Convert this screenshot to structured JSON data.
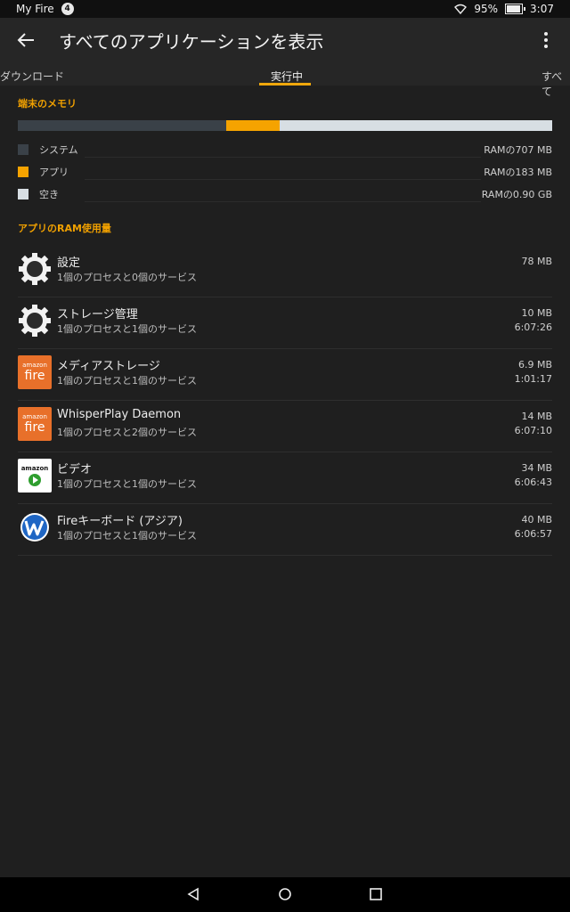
{
  "status_bar": {
    "carrier": "My Fire",
    "notification_count": "4",
    "battery": "95%",
    "time": "3:07",
    "icons": [
      "wifi-icon",
      "battery-charging-icon"
    ]
  },
  "app_bar": {
    "title": "すべてのアプリケーションを表示",
    "back_icon": "back-arrow-icon",
    "menu_icon": "overflow-menu-icon"
  },
  "tabs": {
    "items": [
      {
        "label": "ダウンロード"
      },
      {
        "label": "実行中",
        "selected": true
      },
      {
        "label": "すべて"
      }
    ]
  },
  "memory": {
    "header": "端末のメモリ",
    "usage": [
      {
        "label": "システム",
        "value": "RAMの707 MB",
        "color": "#3a4148",
        "fraction": 0.39
      },
      {
        "label": "アプリ",
        "value": "RAMの183 MB",
        "color": "#f5a300",
        "fraction": 0.1
      },
      {
        "label": "空き",
        "value": "RAMの0.90 GB",
        "color": "#d7dee3",
        "fraction": 0.51
      }
    ]
  },
  "apps": {
    "header": "アプリのRAM使用量",
    "items": [
      {
        "name": "設定",
        "sub": "1個のプロセスと0個のサービス",
        "size": "78 MB",
        "time": "",
        "icon": "gear-icon"
      },
      {
        "name": "ストレージ管理",
        "sub": "1個のプロセスと1個のサービス",
        "size": "10 MB",
        "time": "6:07:26",
        "icon": "gear-icon"
      },
      {
        "name": "メディアストレージ",
        "sub": "1個のプロセスと1個のサービス",
        "size": "6.9 MB",
        "time": "1:01:17",
        "icon": "amazon-fire-icon",
        "icon_text_small": "amazon",
        "icon_text_big": "fire"
      },
      {
        "name": "WhisperPlay Daemon",
        "sub": "1個のプロセスと2個のサービス",
        "size": "14 MB",
        "time": "6:07:10",
        "icon": "amazon-fire-icon",
        "icon_text_small": "amazon",
        "icon_text_big": "fire"
      },
      {
        "name": "ビデオ",
        "sub": "1個のプロセスと1個のサービス",
        "size": "34 MB",
        "time": "6:06:43",
        "icon": "amazon-video-icon",
        "icon_text_small": "amazon"
      },
      {
        "name": "Fireキーボード (アジア)",
        "sub": "1個のプロセスと1個のサービス",
        "size": "40 MB",
        "time": "6:06:57",
        "icon": "keyboard-w-icon"
      }
    ]
  },
  "nav_bar": {
    "icons": [
      "back-triangle-icon",
      "home-circle-icon",
      "recents-square-icon"
    ]
  }
}
